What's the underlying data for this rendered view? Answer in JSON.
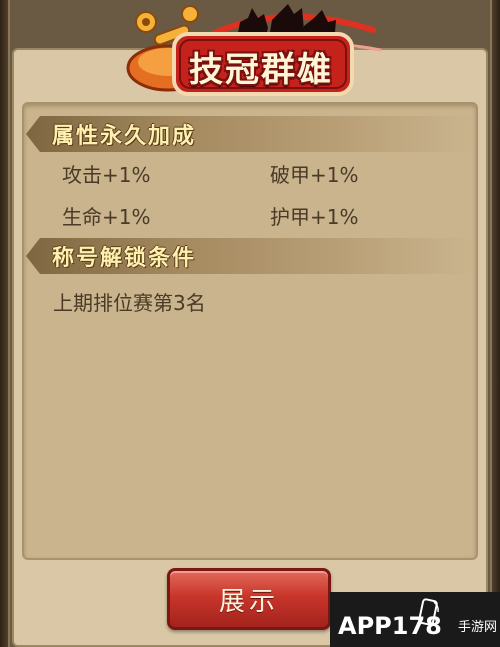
{
  "title_emblem": {
    "text": "技冠群雄"
  },
  "section_attributes": {
    "header": "属性永久加成",
    "items": [
      {
        "label": "攻击+1%"
      },
      {
        "label": "破甲+1%"
      },
      {
        "label": "生命+1%"
      },
      {
        "label": "护甲+1%"
      }
    ]
  },
  "section_unlock": {
    "header": "称号解锁条件",
    "condition": "上期排位赛第3名"
  },
  "show_button": {
    "label": "展示"
  },
  "watermark": {
    "main": "APP178",
    "sub": "手游网"
  },
  "colors": {
    "parchment": "#d9c7a5",
    "header_text": "#fff0b0",
    "button_red": "#c8352b",
    "body_text": "#4a3a26"
  }
}
